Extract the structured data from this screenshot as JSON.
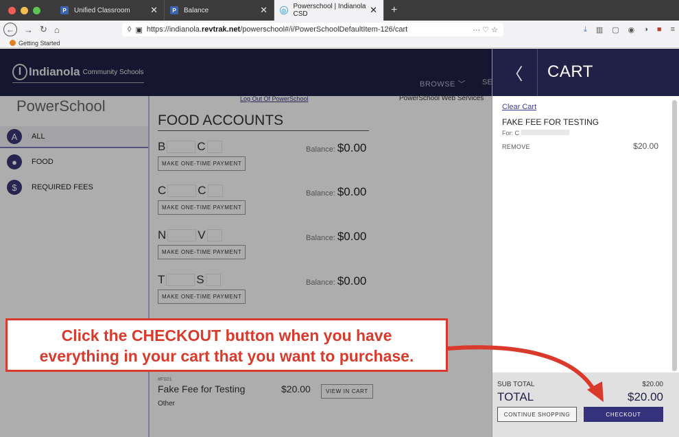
{
  "browser": {
    "tabs": [
      {
        "label": "Unified Classroom",
        "icon": "P"
      },
      {
        "label": "Balance",
        "icon": "P"
      },
      {
        "label": "Powerschool | Indianola CSD",
        "icon": "globe"
      }
    ],
    "url_prefix": "https://indianola.",
    "url_domain": "revtrak.net",
    "url_suffix": "/powerschool#/i/PowerSchoolDefaultItem-126/cart",
    "bookmark": "Getting Started"
  },
  "header": {
    "logo_text": "Indianola",
    "logo_sub": "Community Schools",
    "browse": "BROWSE",
    "se": "SE"
  },
  "sidebar": {
    "title": "PowerSchool",
    "items": [
      {
        "label": "ALL",
        "icon": "A"
      },
      {
        "label": "FOOD",
        "icon": "apple-icon"
      },
      {
        "label": "REQUIRED FEES",
        "icon": "$"
      }
    ]
  },
  "content": {
    "logout": "Log Out Of PowerSchool",
    "services": "PowerSchool Web Services",
    "section_title": "FOOD ACCOUNTS",
    "balance_label": "Balance:",
    "pay_label": "MAKE ONE-TIME PAYMENT",
    "accounts": [
      {
        "first": "B",
        "last": "C",
        "balance": "$0.00"
      },
      {
        "first": "C",
        "last": "C",
        "balance": "$0.00"
      },
      {
        "first": "N",
        "last": "V",
        "balance": "$0.00"
      },
      {
        "first": "T",
        "last": "S",
        "balance": "$0.00"
      }
    ],
    "item_code": "#FS01",
    "item_name": "Fake Fee for Testing",
    "item_category": "Other",
    "item_price": "$20.00",
    "view_cart": "VIEW IN CART"
  },
  "cart": {
    "title": "CART",
    "clear": "Clear Cart",
    "fee_name": "FAKE FEE FOR TESTING",
    "for_text": "For: C",
    "remove": "REMOVE",
    "fee_price": "$20.00",
    "subtotal_label": "SUB TOTAL",
    "subtotal": "$20.00",
    "total_label": "TOTAL",
    "total": "$20.00",
    "continue": "CONTINUE SHOPPING",
    "checkout": "CHECKOUT"
  },
  "callout": {
    "line1": "Click the CHECKOUT button when you have",
    "line2": "everything in your cart that you want to purchase."
  }
}
